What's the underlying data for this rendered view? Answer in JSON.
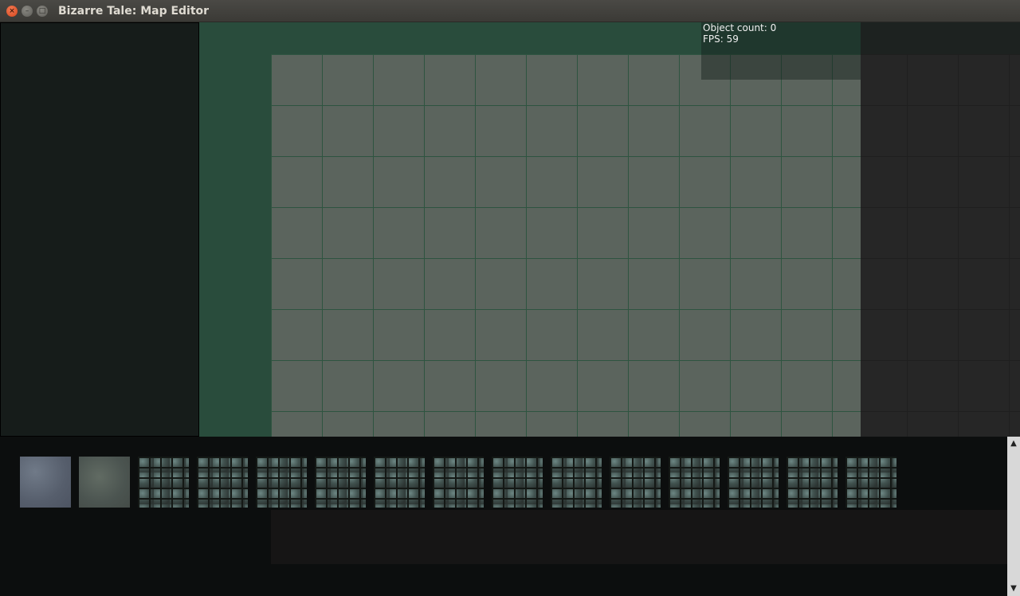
{
  "window": {
    "title": "Bizarre Tale: Map Editor",
    "close_glyph": "×",
    "minimize_glyph": "–",
    "maximize_glyph": "□"
  },
  "stats": {
    "object_count": "Object count: 0",
    "fps": "FPS: 59"
  },
  "palette": {
    "tiles": [
      {
        "kind": "plain-blue-tile"
      },
      {
        "kind": "plain-green-tile"
      },
      {
        "kind": "stone-wall-tile"
      },
      {
        "kind": "stone-wall-tile"
      },
      {
        "kind": "stone-wall-tile"
      },
      {
        "kind": "stone-wall-tile"
      },
      {
        "kind": "stone-wall-tile"
      },
      {
        "kind": "stone-wall-tile"
      },
      {
        "kind": "stone-wall-tile"
      },
      {
        "kind": "stone-wall-tile"
      },
      {
        "kind": "stone-wall-tile"
      },
      {
        "kind": "stone-wall-tile"
      },
      {
        "kind": "stone-wall-tile"
      },
      {
        "kind": "stone-wall-tile"
      },
      {
        "kind": "stone-wall-tile"
      }
    ]
  },
  "scrollbar": {
    "up_glyph": "▲",
    "down_glyph": "▼"
  },
  "colors": {
    "map_fill": "#5b645d",
    "grid_line": "#2e5440",
    "border_green": "#294c3c",
    "panel_bg": "#161c1a"
  }
}
